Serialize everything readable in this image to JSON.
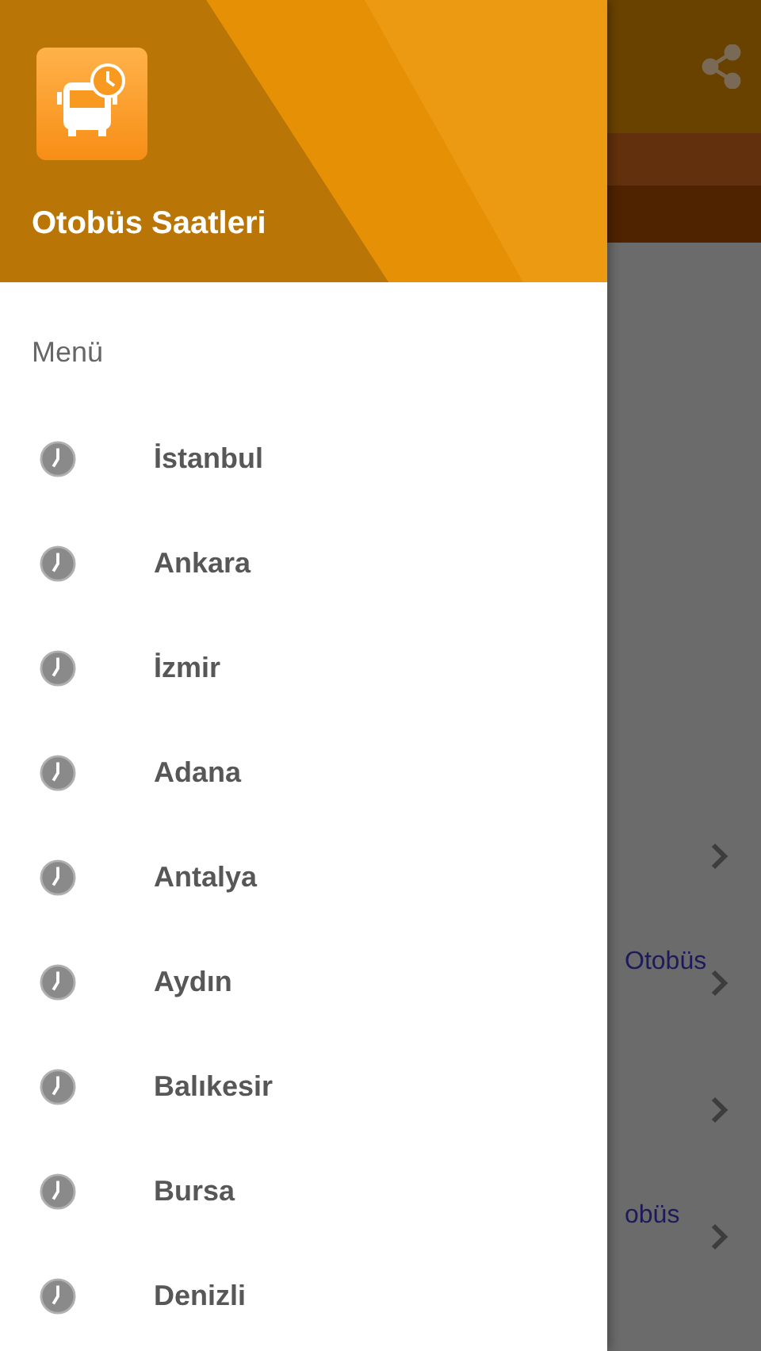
{
  "background": {
    "rows": [
      {
        "kind": "chevron"
      },
      {
        "kind": "chevron",
        "text": "Otobüs"
      },
      {
        "kind": "chevron"
      },
      {
        "kind": "chevron",
        "text": "obüs"
      }
    ]
  },
  "drawer": {
    "title": "Otobüs Saatleri",
    "menu_label": "Menü",
    "items": [
      {
        "label": "İstanbul"
      },
      {
        "label": "Ankara"
      },
      {
        "label": "İzmir"
      },
      {
        "label": "Adana"
      },
      {
        "label": "Antalya"
      },
      {
        "label": "Aydın"
      },
      {
        "label": "Balıkesir"
      },
      {
        "label": "Bursa"
      },
      {
        "label": "Denizli"
      }
    ]
  }
}
